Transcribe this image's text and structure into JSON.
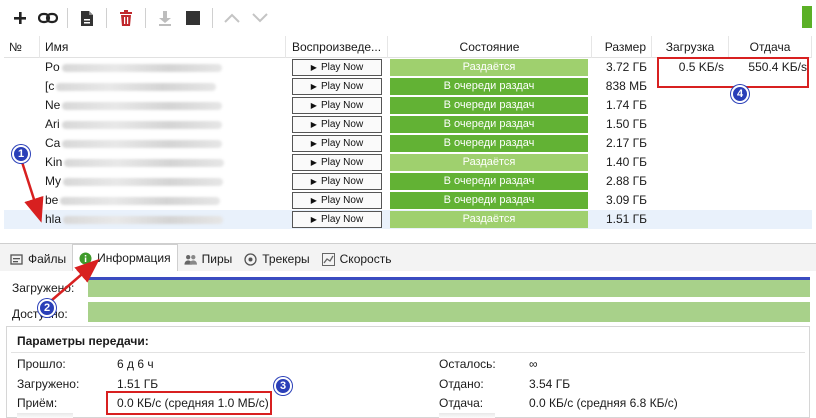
{
  "toolbar": {
    "buttons": [
      {
        "name": "add-icon",
        "glyph": "+"
      },
      {
        "name": "link-icon",
        "glyph": "link"
      },
      {
        "name": "file-icon",
        "glyph": "file"
      },
      {
        "name": "delete-icon",
        "glyph": "trash"
      },
      {
        "name": "download-icon",
        "glyph": "down"
      },
      {
        "name": "stop-icon",
        "glyph": "stop"
      },
      {
        "name": "chevron-up-icon",
        "glyph": "up"
      },
      {
        "name": "chevron-down-icon",
        "glyph": "down"
      }
    ]
  },
  "table": {
    "headers": {
      "num": "№",
      "name": "Имя",
      "play": "Воспроизведе...",
      "state": "Состояние",
      "size": "Размер",
      "down": "Загрузка",
      "up": "Отдача"
    },
    "play_label": "Play Now",
    "rows": [
      {
        "name_visible": "Po",
        "state": "Раздаётся",
        "state_color": "#9fd06e",
        "size": "3.72 ГБ",
        "down": "0.5 KБ/s",
        "up": "550.4 KБ/s"
      },
      {
        "name_visible": "[c",
        "state": "В очереди раздач",
        "state_color": "#62b234",
        "size": "838 МБ",
        "down": "",
        "up": ""
      },
      {
        "name_visible": "Ne",
        "state": "В очереди раздач",
        "state_color": "#62b234",
        "size": "1.74 ГБ",
        "down": "",
        "up": ""
      },
      {
        "name_visible": "Ari",
        "state": "В очереди раздач",
        "state_color": "#62b234",
        "size": "1.50 ГБ",
        "down": "",
        "up": ""
      },
      {
        "name_visible": "Ca",
        "state": "В очереди раздач",
        "state_color": "#62b234",
        "size": "2.17 ГБ",
        "down": "",
        "up": ""
      },
      {
        "name_visible": "Kin",
        "state": "Раздаётся",
        "state_color": "#9fd06e",
        "size": "1.40 ГБ",
        "down": "",
        "up": ""
      },
      {
        "name_visible": "My",
        "state": "В очереди раздач",
        "state_color": "#62b234",
        "size": "2.88 ГБ",
        "down": "",
        "up": ""
      },
      {
        "name_visible": "be",
        "state": "В очереди раздач",
        "state_color": "#62b234",
        "size": "3.09 ГБ",
        "down": "",
        "up": ""
      },
      {
        "name_visible": "hla",
        "state": "Раздаётся",
        "state_color": "#9fd06e",
        "size": "1.51 ГБ",
        "down": "",
        "up": ""
      }
    ]
  },
  "tabs": [
    {
      "label": "Файлы",
      "icon": "files-icon",
      "active": false
    },
    {
      "label": "Информация",
      "icon": "info-icon",
      "active": true
    },
    {
      "label": "Пиры",
      "icon": "peers-icon",
      "active": false
    },
    {
      "label": "Трекеры",
      "icon": "trackers-icon",
      "active": false
    },
    {
      "label": "Скорость",
      "icon": "speed-icon",
      "active": false
    }
  ],
  "progress": {
    "downloaded_label": "Загружено:",
    "available_label": "Доступно:"
  },
  "params": {
    "title": "Параметры передачи:",
    "left": [
      {
        "label": "Прошло:",
        "value": "6 д 6 ч"
      },
      {
        "label": "Загружено:",
        "value": "1.51 ГБ"
      },
      {
        "label": "Приём:",
        "value": "0.0 КБ/с (средняя 1.0 МБ/с)"
      }
    ],
    "right": [
      {
        "label": "Осталось:",
        "value": "∞"
      },
      {
        "label": "Отдано:",
        "value": "3.54 ГБ"
      },
      {
        "label": "Отдача:",
        "value": "0.0 КБ/с (средняя 6.8 КБ/с)"
      }
    ]
  },
  "annotations": {
    "badges": [
      "1",
      "2",
      "3",
      "4"
    ],
    "color": "#d82020"
  },
  "colors": {
    "seeding": "#9fd06e",
    "queued": "#62b234",
    "progress": "#a8d18a",
    "progress_stripe": "#3a4bc0",
    "badge": "#2a3fb8"
  }
}
